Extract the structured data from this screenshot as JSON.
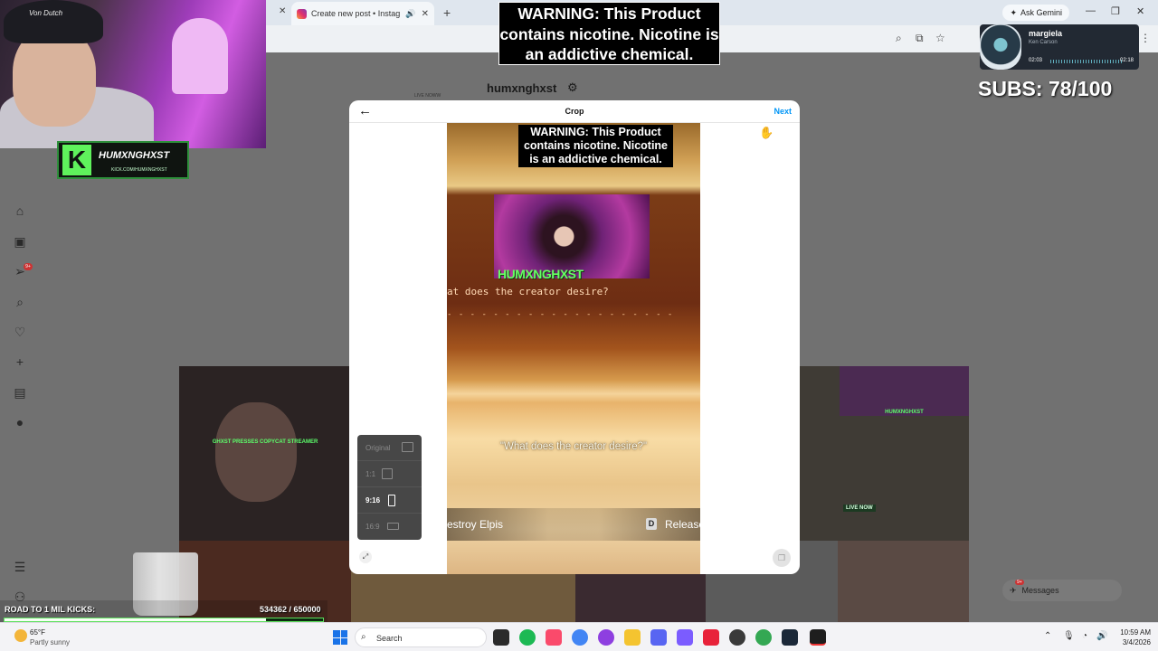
{
  "browser": {
    "tab_title": "Create new post • Instagram",
    "ask_gemini": "Ask Gemini"
  },
  "instagram": {
    "profile_name": "humxnghxst",
    "live_now_small": "LIVE NOWW",
    "thumb_caption": "GHXST PRESSES COPYCAT STREAMER",
    "thumb_right_caption": "HUMXNGHXST",
    "live_now": "LIVE NOW",
    "notif_badge": "9+",
    "messages_badge": "9+",
    "messages_label": "Messages"
  },
  "crop_modal": {
    "title": "Crop",
    "next_label": "Next",
    "video": {
      "warning_text": "WARNING: This Product contains nicotine. Nicotine is an addictive chemical.",
      "streamer_logo": "HUMXNGHXST",
      "terminal_text": "at does the creator desire?",
      "dashes": "- - - - - - - - - - - - - - - - - - - -",
      "subtitle": "\"What does the creator desire?\"",
      "action_left": "estroy Elpis",
      "action_key": "D",
      "action_right": "Release"
    },
    "aspect_options": [
      {
        "label": "Original",
        "selected": false
      },
      {
        "label": "1:1",
        "selected": false
      },
      {
        "label": "9:16",
        "selected": true
      },
      {
        "label": "16:9",
        "selected": false
      }
    ]
  },
  "stream_overlay": {
    "warning_text": "WARNING: This Product contains nicotine. Nicotine is an addictive chemical.",
    "kick_name": "HUMXNGHXST",
    "kick_url": "KICK.COM/HUMXNGHXST",
    "hat_text": "Von Dutch",
    "now_playing": {
      "song": "margiela",
      "artist": "Ken Carson",
      "elapsed": "02:03",
      "duration": "02:18"
    },
    "subs_text": "SUBS: 78/100",
    "goal": {
      "label": "ROAD TO 1 MIL KICKS:",
      "current": 534362,
      "target": 650000,
      "value_text": "534362  / 650000"
    }
  },
  "taskbar": {
    "temperature": "65°F",
    "condition": "Partly sunny",
    "search_placeholder": "Search",
    "time": "10:59 AM",
    "date": "3/4/2026"
  },
  "colors": {
    "instagram_blue": "#0095f6",
    "kick_green": "#5ff25c",
    "windows_blue": "#1a73e8"
  }
}
